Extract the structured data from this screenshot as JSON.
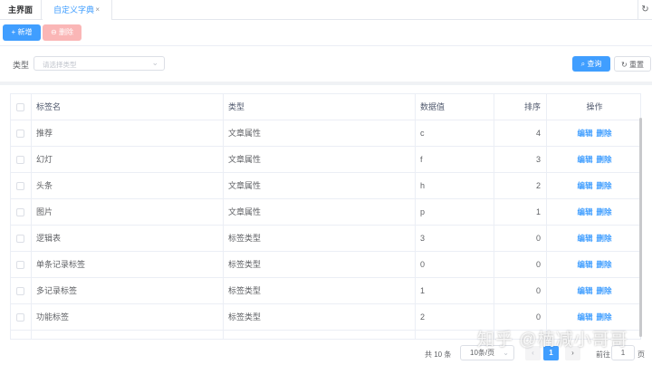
{
  "tabs": {
    "home": "主界面",
    "dict": "自定义字典",
    "close": "×",
    "refresh": "↻"
  },
  "toolbar": {
    "add_label": "+ 新增",
    "delete_label": "⊖ 删除"
  },
  "filter": {
    "type_label": "类型",
    "type_placeholder": "请选择类型",
    "arrow": "⌄",
    "query_label": "⌕ 查询",
    "reset_label": "↻ 重置"
  },
  "table": {
    "headers": {
      "name": "标签名",
      "type": "类型",
      "value": "数据值",
      "sort": "排序",
      "actions": "操作"
    },
    "edit_label": "编辑",
    "delete_label": "删除",
    "rows": [
      {
        "name": "推荐",
        "type": "文章属性",
        "value": "c",
        "sort": "4"
      },
      {
        "name": "幻灯",
        "type": "文章属性",
        "value": "f",
        "sort": "3"
      },
      {
        "name": "头条",
        "type": "文章属性",
        "value": "h",
        "sort": "2"
      },
      {
        "name": "图片",
        "type": "文章属性",
        "value": "p",
        "sort": "1"
      },
      {
        "name": "逻辑表",
        "type": "标签类型",
        "value": "3",
        "sort": "0"
      },
      {
        "name": "单条记录标签",
        "type": "标签类型",
        "value": "0",
        "sort": "0"
      },
      {
        "name": "多记录标签",
        "type": "标签类型",
        "value": "1",
        "sort": "0"
      },
      {
        "name": "功能标签",
        "type": "标签类型",
        "value": "2",
        "sort": "0"
      }
    ]
  },
  "pagination": {
    "total_text": "共 10 条",
    "page_size": "10条/页",
    "prev": "‹",
    "current_page": "1",
    "next": "›",
    "goto_label": "前往",
    "goto_value": "1",
    "goto_unit": "页"
  },
  "watermark": "知乎 @楠减小哥哥",
  "colors": {
    "primary": "#409eff",
    "danger_light": "#fab6b6",
    "border": "#ebeef5"
  }
}
